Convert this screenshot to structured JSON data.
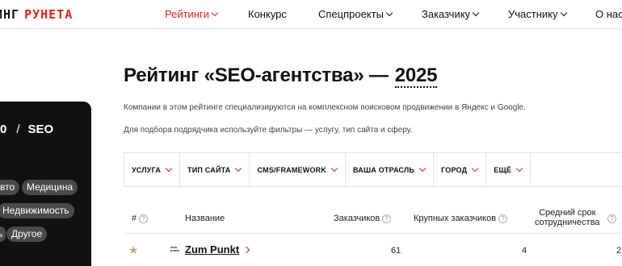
{
  "logo": {
    "part1": "ИНГ",
    "part2": "РУНЕТА"
  },
  "nav": {
    "items": [
      {
        "label": "Рейтинги",
        "active": true,
        "dropdown": true
      },
      {
        "label": "Конкурс",
        "active": false,
        "dropdown": false
      },
      {
        "label": "Спецпроекты",
        "active": false,
        "dropdown": true
      },
      {
        "label": "Заказчику",
        "active": false,
        "dropdown": true
      },
      {
        "label": "Участнику",
        "active": false,
        "dropdown": true
      },
      {
        "label": "О нас",
        "active": false,
        "dropdown": false
      }
    ]
  },
  "page": {
    "title": "Рейтинг «SEO-агентства» —",
    "year": "2025",
    "description1": "Компании в этом рейтинге специализируются на комплексном поисковом продвижении в Яндекс и Google.",
    "description2": "Для подбора подрядчика используйте фильтры — услугу, тип сайта и сферу."
  },
  "sidebar": {
    "crumb_num": "0",
    "crumb_sep": "/",
    "crumb_label": "SEO",
    "tags": [
      "вто",
      "Медицина",
      "Недвижимость",
      "ь",
      "Другое"
    ]
  },
  "filters": [
    "УСЛУГА",
    "ТИП САЙТА",
    "CMS/FRAMEWORK",
    "ВАША ОТРАСЛЬ",
    "ГОРОД",
    "ЕЩЁ"
  ],
  "table": {
    "headers": {
      "rank": "#",
      "name": "Название",
      "clients": "Заказчиков",
      "big_clients": "Крупных заказчиков",
      "duration_line1": "Средний срок",
      "duration_line2": "сотрудничества"
    },
    "rows": [
      {
        "logo_text": "zum punkt",
        "name": "Zum Punkt",
        "clients": "61",
        "big_clients": "4",
        "duration": "2"
      }
    ]
  },
  "colors": {
    "accent": "#e2231a",
    "star": "#c7a76a",
    "dark_panel": "#111111",
    "tag_bg": "#4a4a4a"
  }
}
